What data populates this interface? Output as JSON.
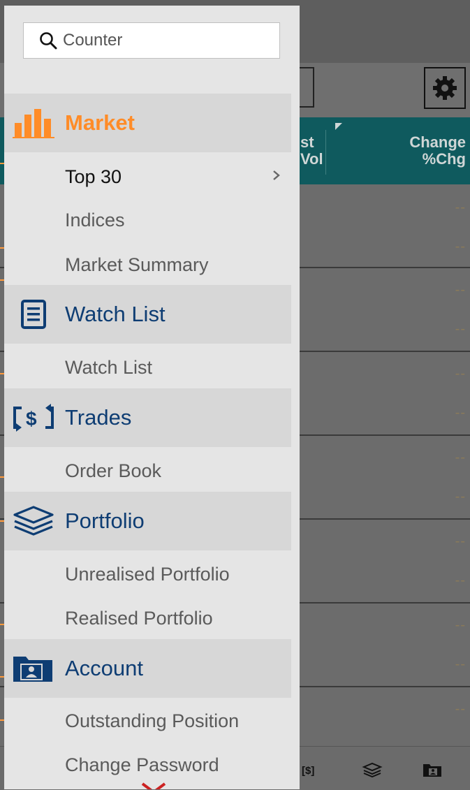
{
  "search": {
    "placeholder": "Counter",
    "icon": "search-icon"
  },
  "menu": [
    {
      "label": "Market",
      "icon": "bar-chart-icon",
      "active": true,
      "items": [
        {
          "label": "Top 30",
          "active": true,
          "chevron": true
        },
        {
          "label": "Indices"
        },
        {
          "label": "Market Summary"
        }
      ]
    },
    {
      "label": "Watch List",
      "icon": "list-icon",
      "items": [
        {
          "label": "Watch List"
        }
      ]
    },
    {
      "label": "Trades",
      "icon": "exchange-dollar-icon",
      "items": [
        {
          "label": "Order Book"
        }
      ]
    },
    {
      "label": "Portfolio",
      "icon": "layers-icon",
      "items": [
        {
          "label": "Unrealised Portfolio"
        },
        {
          "label": "Realised Portfolio"
        }
      ]
    },
    {
      "label": "Account",
      "icon": "account-folder-icon",
      "items": [
        {
          "label": "Outstanding Position"
        },
        {
          "label": "Change Password"
        }
      ]
    }
  ],
  "background": {
    "columns": [
      "st\nVol",
      "Change\n%Chg"
    ],
    "col_a_lines": [
      "st",
      "Vol"
    ],
    "col_b_lines": [
      "Change",
      "%Chg"
    ],
    "empty_value": "--"
  },
  "colors": {
    "accent": "#ff8c28",
    "section_text": "#0e3d73",
    "header_teal": "#0f5a5e",
    "scroll_arrow": "#cc2222"
  }
}
